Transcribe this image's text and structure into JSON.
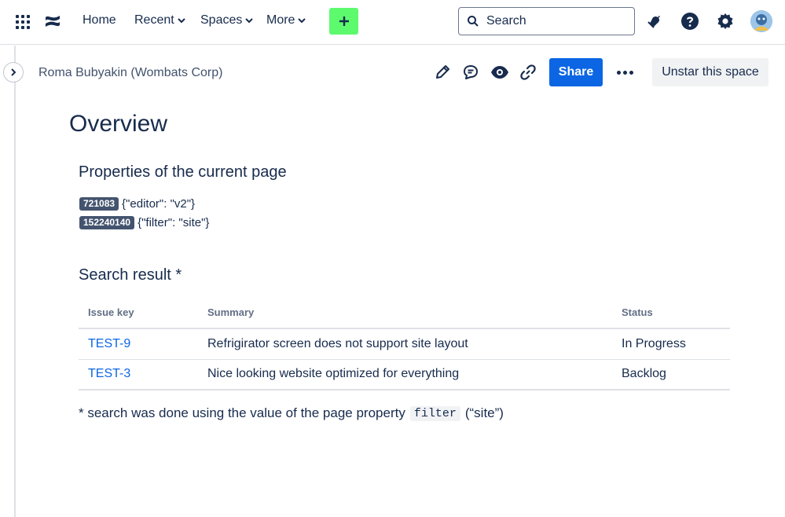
{
  "nav": {
    "items": [
      {
        "label": "Home",
        "has_dropdown": false
      },
      {
        "label": "Recent",
        "has_dropdown": true
      },
      {
        "label": "Spaces",
        "has_dropdown": true
      },
      {
        "label": "More",
        "has_dropdown": true
      }
    ],
    "create_icon": "plus-icon",
    "search_placeholder": "Search",
    "icons": [
      "apps-grid-icon",
      "confluence-logo-icon",
      "notifications-bell-icon",
      "help-icon",
      "settings-gear-icon",
      "user-avatar"
    ],
    "create_color": "#5dfa6e"
  },
  "header": {
    "breadcrumb": "Roma Bubyakin (Wombats Corp)",
    "actions": [
      "edit-pencil-icon",
      "comment-icon",
      "watch-eye-icon",
      "copy-link-icon"
    ],
    "share_label": "Share",
    "unstar_label": "Unstar this space",
    "accent": "#0c66e4"
  },
  "content": {
    "title": "Overview",
    "properties_heading": "Properties of the current page",
    "properties": [
      {
        "id": "721083",
        "value": "{\"editor\": \"v2\"}"
      },
      {
        "id": "152240140",
        "value": "{\"filter\": \"site\"}"
      }
    ],
    "search_heading": "Search result *",
    "table": {
      "headers": [
        "Issue key",
        "Summary",
        "Status"
      ],
      "rows": [
        {
          "key": "TEST-9",
          "summary": "Refrigirator screen does not support site layout",
          "status": "In Progress"
        },
        {
          "key": "TEST-3",
          "summary": "Nice looking website optimized for everything",
          "status": "Backlog"
        }
      ]
    },
    "footnote_before": "* search was done using the value of the page property",
    "footnote_code": "filter",
    "footnote_after": "(“site”)"
  }
}
